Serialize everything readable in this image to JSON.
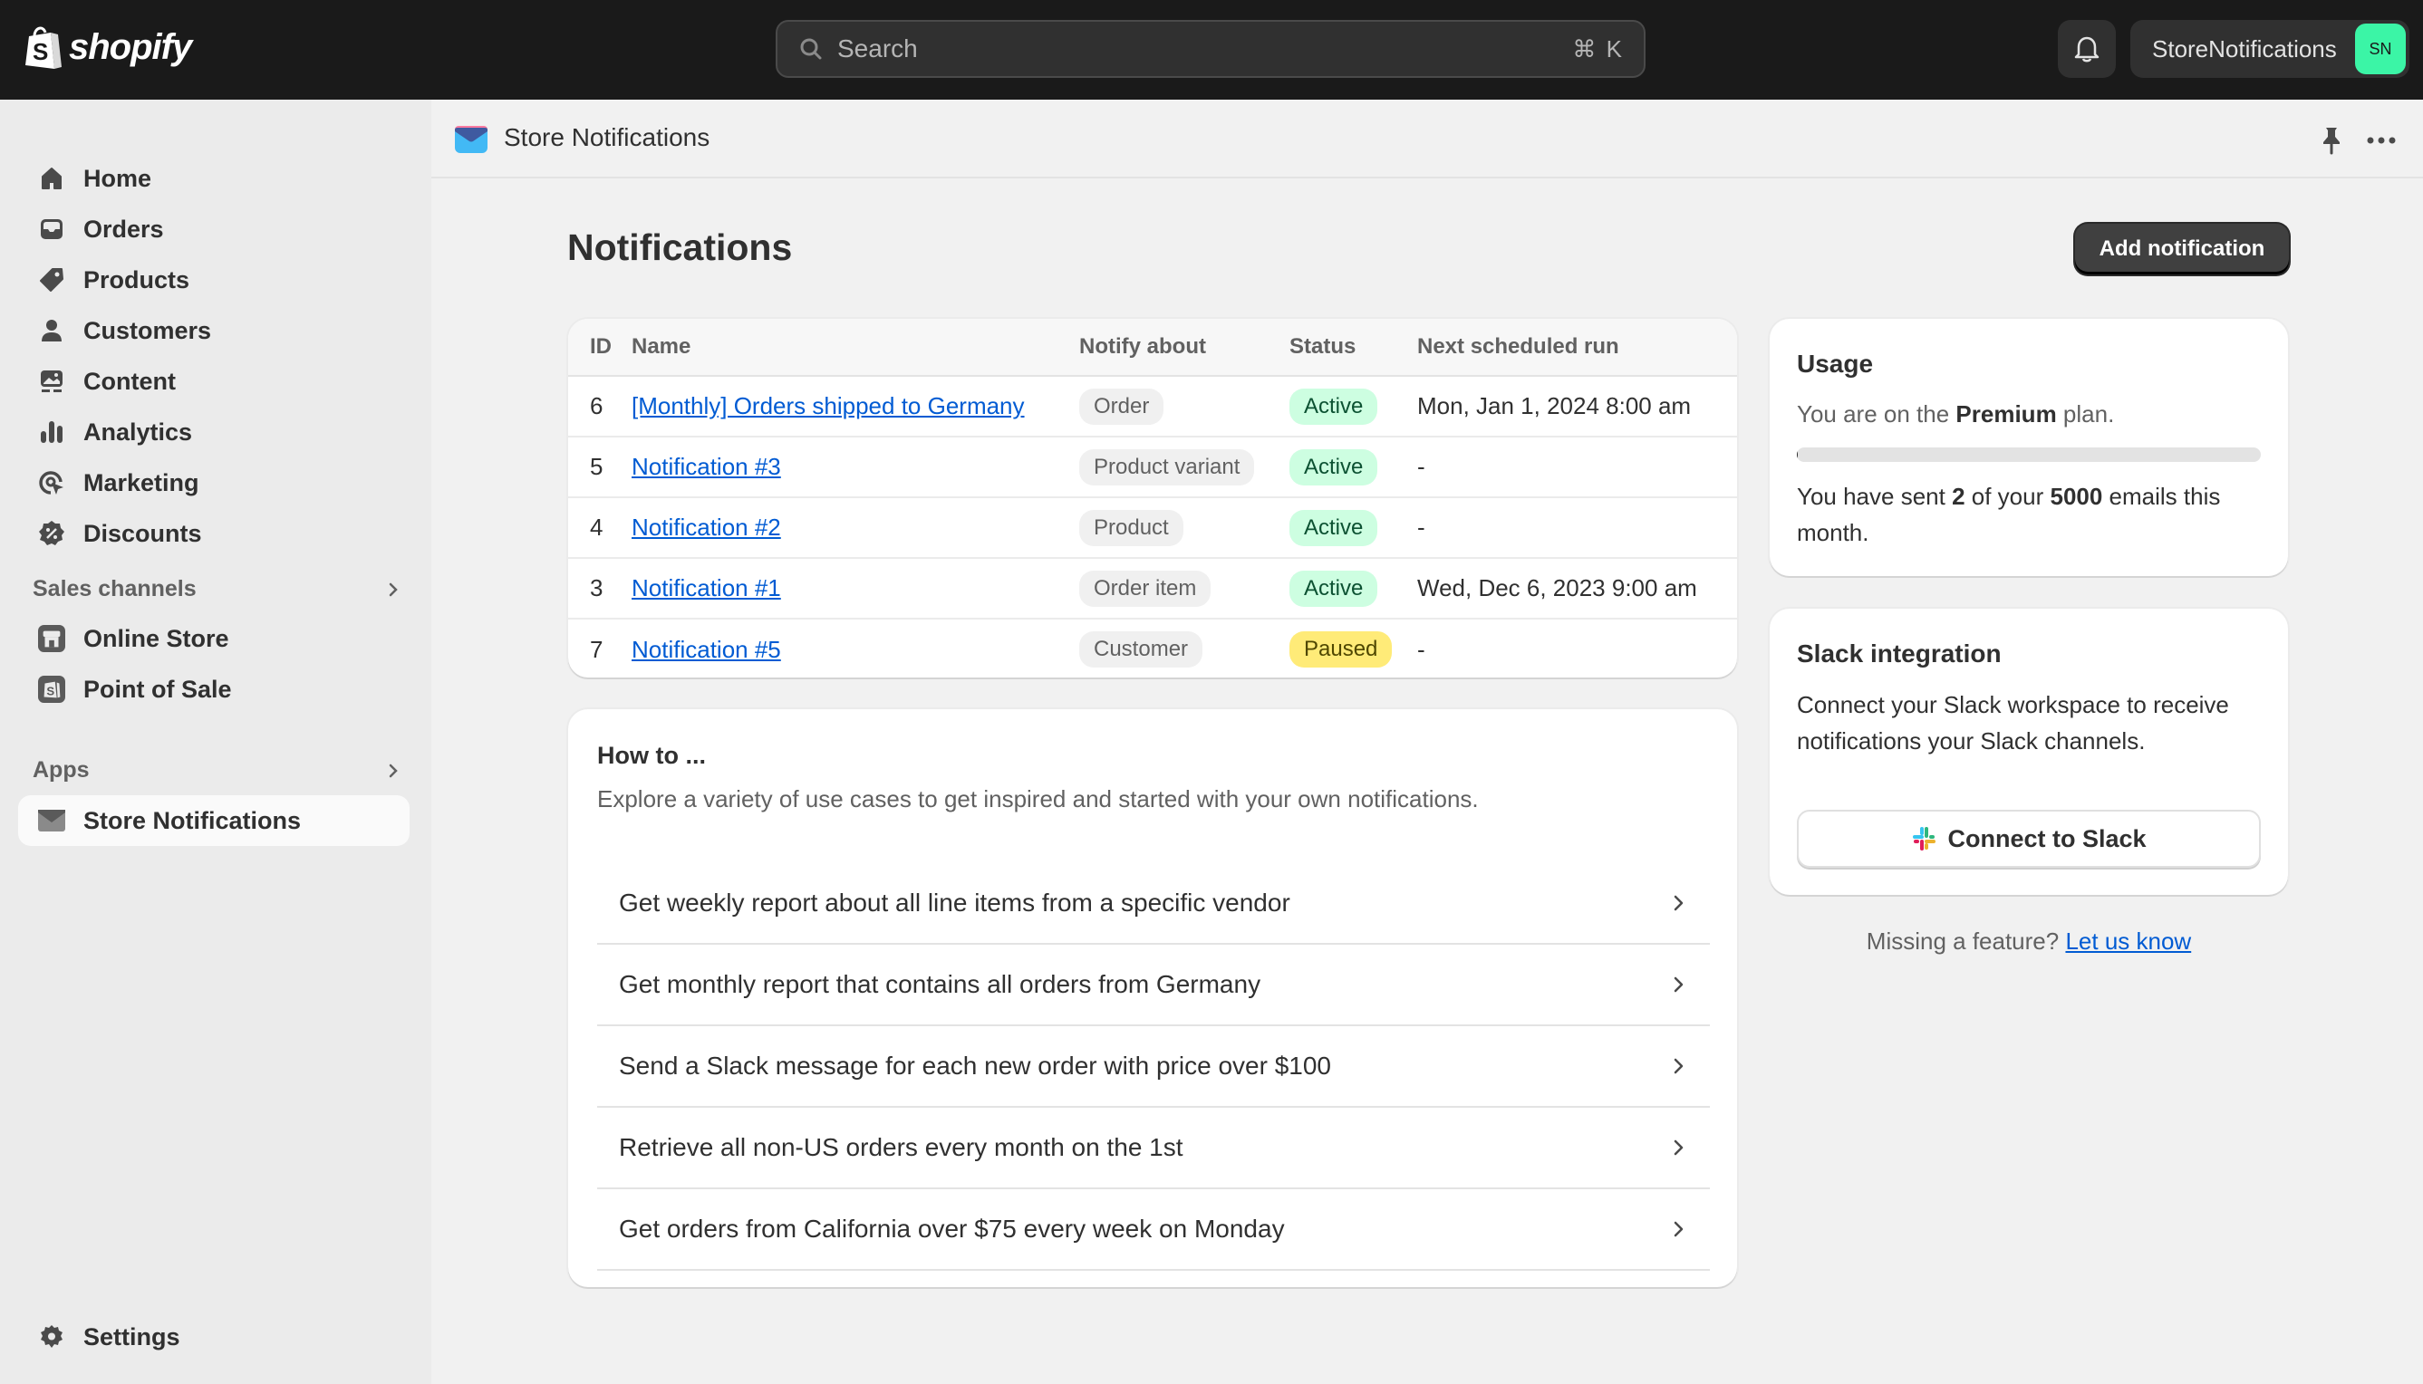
{
  "topbar": {
    "brand": "shopify",
    "search_placeholder": "Search",
    "search_shortcut": "⌘ K",
    "account_name": "StoreNotifications",
    "avatar_initials": "SN",
    "avatar_color": "#3bf5a6"
  },
  "sidebar": {
    "items": [
      {
        "label": "Home",
        "icon": "home-icon"
      },
      {
        "label": "Orders",
        "icon": "inbox-icon"
      },
      {
        "label": "Products",
        "icon": "tag-icon"
      },
      {
        "label": "Customers",
        "icon": "person-icon"
      },
      {
        "label": "Content",
        "icon": "image-icon"
      },
      {
        "label": "Analytics",
        "icon": "bar-chart-icon"
      },
      {
        "label": "Marketing",
        "icon": "target-icon"
      },
      {
        "label": "Discounts",
        "icon": "discount-icon"
      }
    ],
    "sales_channels": {
      "label": "Sales channels",
      "items": [
        {
          "label": "Online Store",
          "icon": "store-icon"
        },
        {
          "label": "Point of Sale",
          "icon": "pos-icon"
        }
      ]
    },
    "apps": {
      "label": "Apps",
      "items": [
        {
          "label": "Store Notifications",
          "icon": "envelope-icon",
          "active": true
        }
      ]
    },
    "settings_label": "Settings"
  },
  "appbar": {
    "title": "Store Notifications"
  },
  "page": {
    "title": "Notifications",
    "add_button": "Add notification"
  },
  "table": {
    "columns": [
      "ID",
      "Name",
      "Notify about",
      "Status",
      "Next scheduled run"
    ],
    "rows": [
      {
        "id": "6",
        "name": "[Monthly] Orders shipped to Germany",
        "notify_about": "Order",
        "status": "Active",
        "next_run": "Mon, Jan 1, 2024 8:00 am"
      },
      {
        "id": "5",
        "name": "Notification #3",
        "notify_about": "Product variant",
        "status": "Active",
        "next_run": "-"
      },
      {
        "id": "4",
        "name": "Notification #2",
        "notify_about": "Product",
        "status": "Active",
        "next_run": "-"
      },
      {
        "id": "3",
        "name": "Notification #1",
        "notify_about": "Order item",
        "status": "Active",
        "next_run": "Wed, Dec 6, 2023 9:00 am"
      },
      {
        "id": "7",
        "name": "Notification #5",
        "notify_about": "Customer",
        "status": "Paused",
        "next_run": "-"
      }
    ]
  },
  "howto": {
    "title": "How to ...",
    "subtitle": "Explore a variety of use cases to get inspired and started with your own notifications.",
    "items": [
      "Get weekly report about all line items from a specific vendor",
      "Get monthly report that contains all orders from Germany",
      "Send a Slack message for each new order with price over $100",
      "Retrieve all non-US orders every month on the 1st",
      "Get orders from California over $75 every week on Monday"
    ]
  },
  "usage": {
    "title": "Usage",
    "plan_prefix": "You are on the ",
    "plan_name": "Premium",
    "plan_suffix": " plan.",
    "sent_prefix": "You have sent ",
    "sent": "2",
    "sent_mid": " of your ",
    "limit": "5000",
    "sent_suffix": " emails this month.",
    "progress_fraction": 0.0004
  },
  "slack": {
    "title": "Slack integration",
    "description": "Connect your Slack workspace to receive notifications your Slack channels.",
    "button": "Connect to Slack"
  },
  "footer": {
    "missing_text": "Missing a feature? ",
    "link_text": "Let us know"
  }
}
